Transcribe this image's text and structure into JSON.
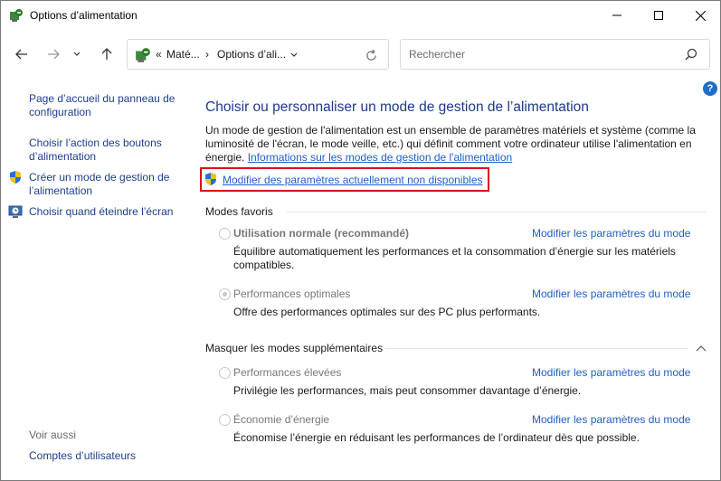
{
  "window": {
    "title": "Options d’alimentation"
  },
  "nav": {
    "breadcrumb_prefix": "«",
    "breadcrumb_1": "Maté...",
    "breadcrumb_sep": "›",
    "breadcrumb_2": "Options d’ali...",
    "search_placeholder": "Rechercher"
  },
  "help": "?",
  "sidebar": {
    "links": [
      {
        "line1": "Page d’accueil du panneau de",
        "line2": "configuration"
      },
      {
        "line1": "Choisir l’action des boutons",
        "line2": "d’alimentation"
      },
      {
        "line1": "Créer un mode de gestion de",
        "line2": "l’alimentation"
      },
      {
        "line1": "Choisir quand éteindre l’écran",
        "line2": ""
      }
    ],
    "see_also": "Voir aussi",
    "user_accounts": "Comptes d’utilisateurs"
  },
  "main": {
    "title": "Choisir ou personnaliser un mode de gestion de l’alimentation",
    "desc": "Un mode de gestion de l'alimentation est un ensemble de paramètres matériels et système (comme la luminosité de l'écran, le mode veille, etc.) qui définit comment votre ordinateur utilise l'alimentation en énergie.",
    "desc_link": "Informations sur les modes de gestion de l'alimentation",
    "modify_link": "Modifier des paramètres actuellement non disponibles",
    "favorites_label": "Modes favoris",
    "hidden_label": "Masquer les modes supplémentaires",
    "plan_link": "Modifier les paramètres du mode"
  },
  "plans": [
    {
      "name": "Utilisation normale (recommandé)",
      "desc": "Équilibre automatiquement les performances et la consommation d’énergie sur les matériels compatibles."
    },
    {
      "name": "Performances optimales",
      "desc": "Offre des performances optimales sur des PC plus performants."
    },
    {
      "name": "Performances élevées",
      "desc": "Privilégie les performances, mais peut consommer davantage d’énergie."
    },
    {
      "name": "Économie d’énergie",
      "desc": "Économise l’énergie en réduisant les performances de l’ordinateur dès que possible."
    }
  ]
}
